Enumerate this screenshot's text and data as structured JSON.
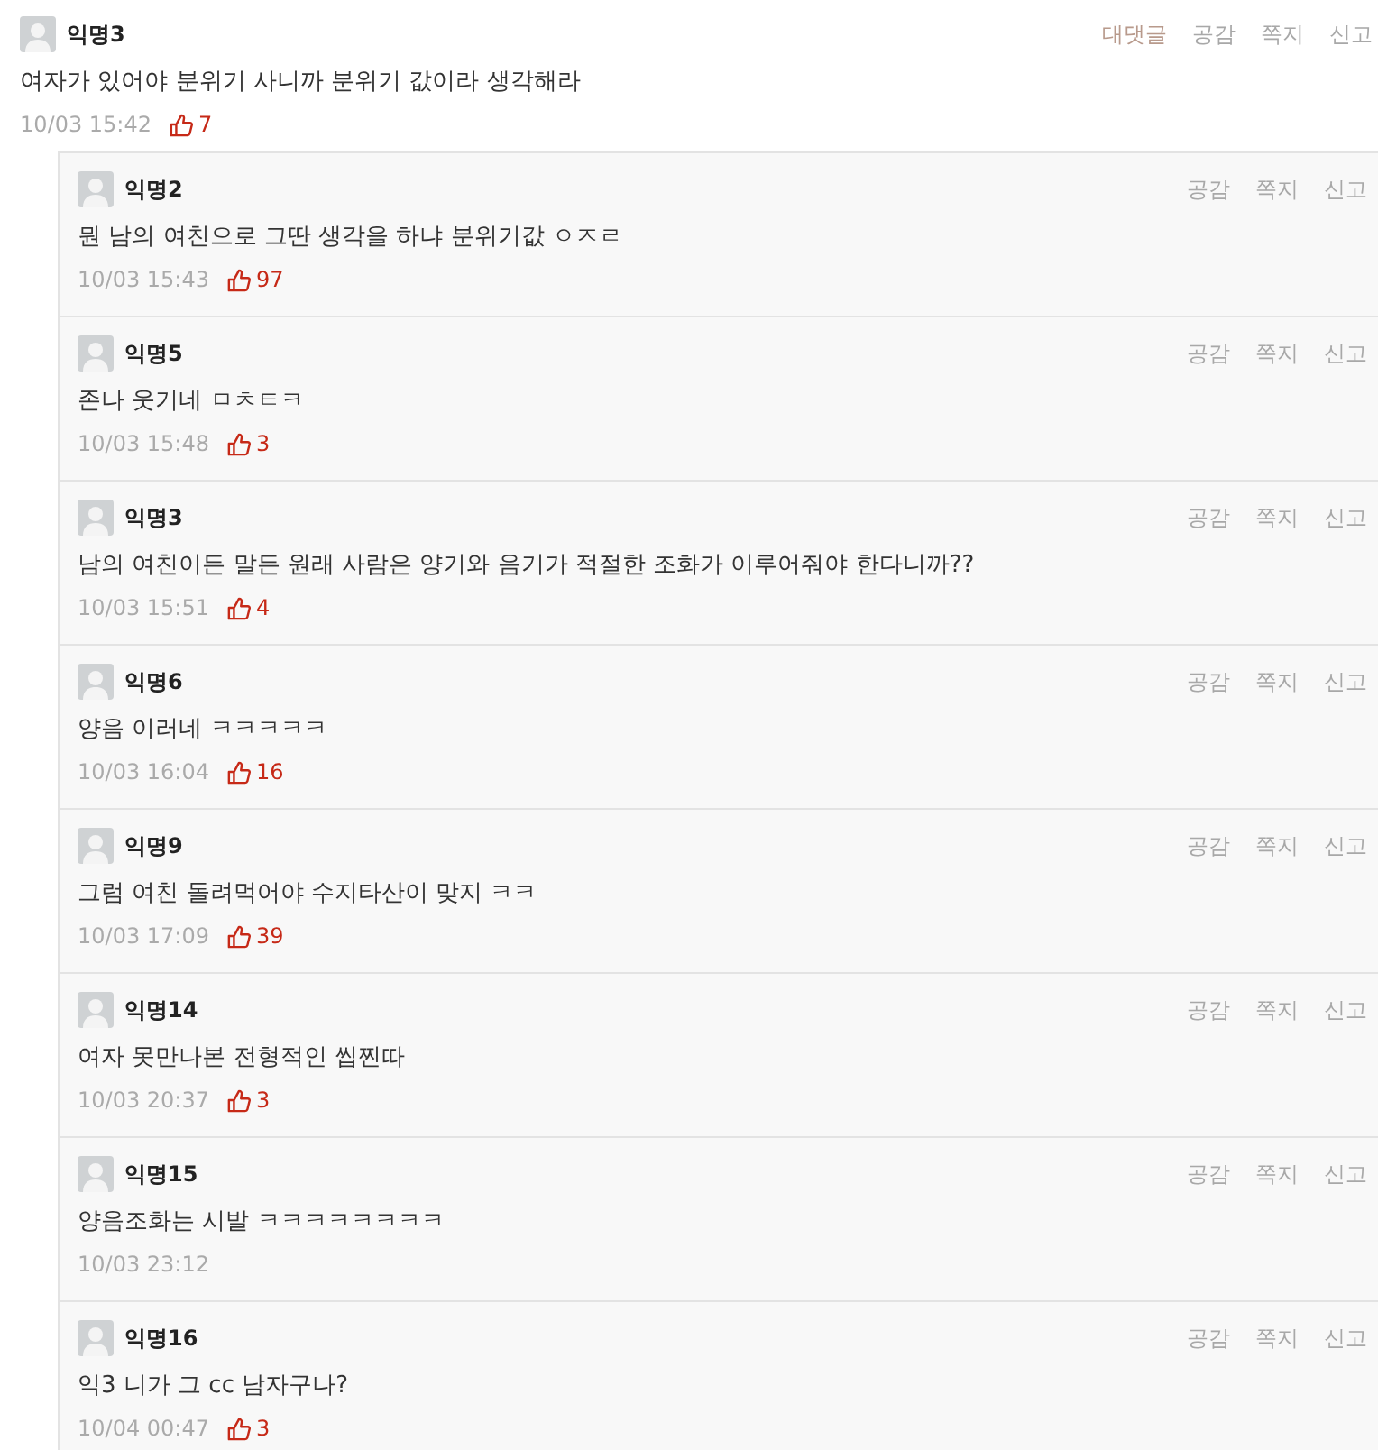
{
  "comment": {
    "author": "익명3",
    "text": "여자가 있어야 분위기 사니까 분위기 값이라 생각해라",
    "time": "10/03 15:42",
    "likes": "7",
    "actions": [
      "대댓글",
      "공감",
      "쪽지",
      "신고"
    ]
  },
  "replies": [
    {
      "author": "익명2",
      "text": "뭔 남의 여친으로 그딴 생각을 하냐 분위기값 ㅇㅈㄹ",
      "time": "10/03 15:43",
      "likes": "97",
      "actions": [
        "공감",
        "쪽지",
        "신고"
      ]
    },
    {
      "author": "익명5",
      "text": "존나 웃기네 ㅁㅊㅌㅋ",
      "time": "10/03 15:48",
      "likes": "3",
      "actions": [
        "공감",
        "쪽지",
        "신고"
      ]
    },
    {
      "author": "익명3",
      "text": "남의 여친이든 말든 원래 사람은 양기와 음기가 적절한 조화가 이루어줘야 한다니까??",
      "time": "10/03 15:51",
      "likes": "4",
      "actions": [
        "공감",
        "쪽지",
        "신고"
      ]
    },
    {
      "author": "익명6",
      "text": "양음 이러네 ㅋㅋㅋㅋㅋ",
      "time": "10/03 16:04",
      "likes": "16",
      "actions": [
        "공감",
        "쪽지",
        "신고"
      ]
    },
    {
      "author": "익명9",
      "text": "그럼 여친 돌려먹어야 수지타산이 맞지 ㅋㅋ",
      "time": "10/03 17:09",
      "likes": "39",
      "actions": [
        "공감",
        "쪽지",
        "신고"
      ]
    },
    {
      "author": "익명14",
      "text": "여자 못만나본 전형적인 씹찐따",
      "time": "10/03 20:37",
      "likes": "3",
      "actions": [
        "공감",
        "쪽지",
        "신고"
      ]
    },
    {
      "author": "익명15",
      "text": "양음조화는 시발 ㅋㅋㅋㅋㅋㅋㅋㅋ",
      "time": "10/03 23:12",
      "actions": [
        "공감",
        "쪽지",
        "신고"
      ]
    },
    {
      "author": "익명16",
      "text": "익3 니가 그 cc 남자구나?",
      "time": "10/04 00:47",
      "likes": "3",
      "actions": [
        "공감",
        "쪽지",
        "신고"
      ]
    }
  ]
}
